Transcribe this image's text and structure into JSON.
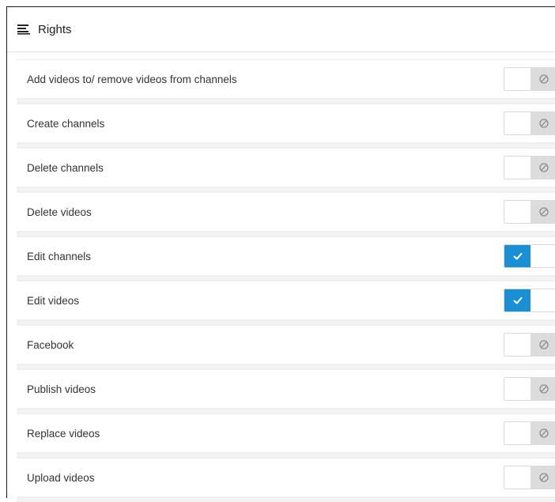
{
  "panel": {
    "title": "Rights",
    "title_icon": "lines-icon"
  },
  "rights": [
    {
      "label": "Add videos to/ remove videos from channels",
      "enabled": false
    },
    {
      "label": "Create channels",
      "enabled": false
    },
    {
      "label": "Delete channels",
      "enabled": false
    },
    {
      "label": "Delete videos",
      "enabled": false
    },
    {
      "label": "Edit channels",
      "enabled": true
    },
    {
      "label": "Edit videos",
      "enabled": true
    },
    {
      "label": "Facebook",
      "enabled": false
    },
    {
      "label": "Publish videos",
      "enabled": false
    },
    {
      "label": "Replace videos",
      "enabled": false
    },
    {
      "label": "Upload videos",
      "enabled": false
    }
  ],
  "colors": {
    "accent": "#1b8fd4",
    "off_track": "#dcdcdc",
    "row_background": "#ffffff",
    "list_background": "#f2f2f2"
  },
  "icons": {
    "on": "checkmark-icon",
    "off": "disabled-circle-icon"
  }
}
